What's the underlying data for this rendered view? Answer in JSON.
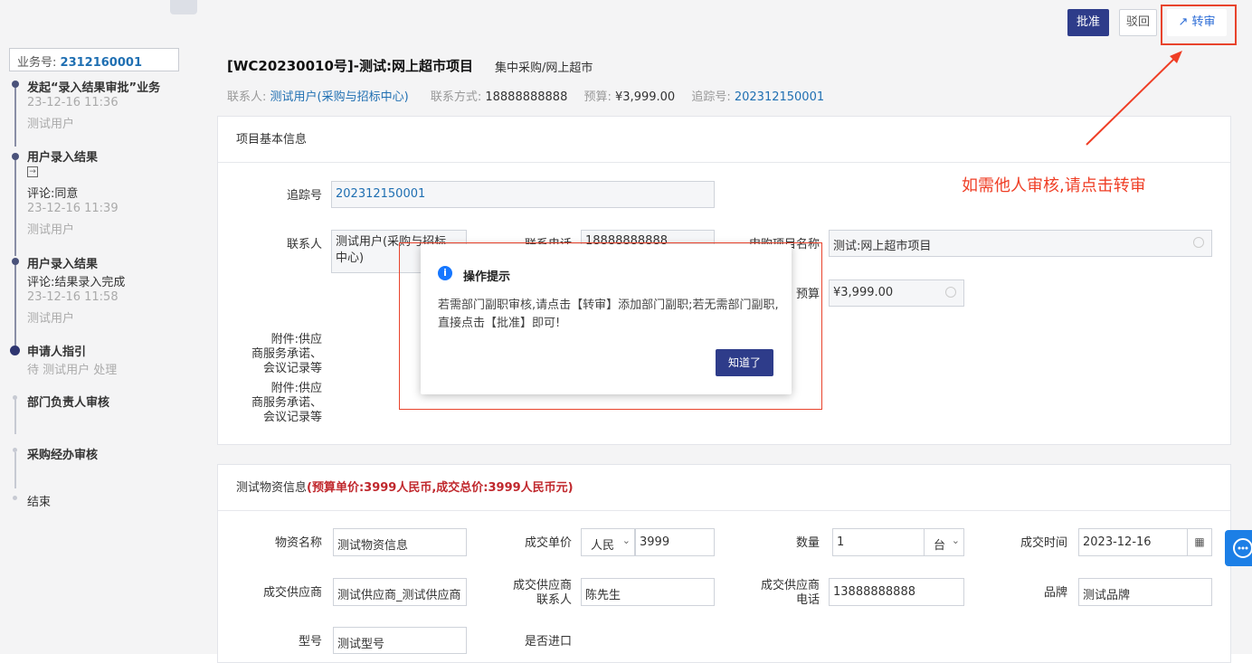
{
  "sidebar": {
    "business_no_label": "业务号:",
    "business_no": "2312160001",
    "timeline": [
      {
        "title": "发起“录入结果审批”业务",
        "time": "23-12-16 11:36",
        "user": "测试用户"
      },
      {
        "title": "用户录入结果",
        "icon": "enter-icon",
        "comment": "评论:同意",
        "time": "23-12-16 11:39",
        "user": "测试用户"
      },
      {
        "title": "用户录入结果",
        "comment": "评论:结果录入完成",
        "time": "23-12-16 11:58",
        "user": "测试用户"
      },
      {
        "title": "申请人指引",
        "status": "待 测试用户 处理"
      },
      {
        "title": "部门负责人审核"
      },
      {
        "title": "采购经办审核"
      },
      {
        "title": "结束"
      }
    ]
  },
  "toolbar": {
    "approve": "批准",
    "reject": "驳回",
    "transfer": "转审",
    "transfer_icon": "share-icon"
  },
  "header": {
    "title": "[WC20230010号]-测试:网上超市项目",
    "subtitle": "集中采购/网上超市",
    "contact_label": "联系人:",
    "contact_value": "测试用户(采购与招标中心)",
    "phone_label": "联系方式:",
    "phone_value": "18888888888",
    "budget_label": "预算:",
    "budget_value": "¥3,999.00",
    "track_label": "追踪号:",
    "track_value": "202312150001"
  },
  "basic_info": {
    "heading": "项目基本信息",
    "track_label": "追踪号",
    "track_value": "202312150001",
    "contact_label": "联系人",
    "contact_value_line1": "测试用户(采购与招标",
    "contact_value_line2": "中心)",
    "phone_label": "联系电话",
    "phone_value": "18888888888",
    "project_name_label": "申购项目名称",
    "project_name_value": "测试:网上超市项目",
    "budget_label": "预算",
    "budget_value": "¥3,999.00",
    "attach1_label": [
      "附件:供应",
      "商服务承诺、",
      "会议记录等"
    ],
    "attach2_label": [
      "附件:供应",
      "商服务承诺、",
      "会议记录等"
    ]
  },
  "material_info": {
    "heading_prefix": "测试物资信息",
    "heading_highlight": "(预算单价:3999人民币,成交总价:3999人民币元)",
    "name_label": "物资名称",
    "name_value": "测试物资信息",
    "unit_price_label": "成交单价",
    "currency_value": "人民",
    "unit_price_value": "3999",
    "qty_label": "数量",
    "qty_value": "1",
    "qty_unit": "台",
    "date_label": "成交时间",
    "date_value": "2023-12-16",
    "supplier_label": "成交供应商",
    "supplier_value": "测试供应商_测试供应商",
    "supplier_contact_label": [
      "成交供应商",
      "联系人"
    ],
    "supplier_contact_value": "陈先生",
    "supplier_phone_label": [
      "成交供应商",
      "电话"
    ],
    "supplier_phone_value": "13888888888",
    "brand_label": "品牌",
    "brand_value": "测试品牌",
    "model_label": "型号",
    "model_value": "测试型号",
    "import_label": "是否进口"
  },
  "dialog": {
    "title": "操作提示",
    "body": "若需部门副职审核,请点击【转审】添加部门副职;若无需部门副职,直接点击【批准】即可!",
    "ok": "知道了"
  },
  "annotation": "如需他人审核,请点击转审",
  "colors": {
    "primary": "#2e3c8a",
    "link": "#1f6fb2",
    "annotation": "#ef3e25",
    "highlight_box": "#e8432c"
  }
}
